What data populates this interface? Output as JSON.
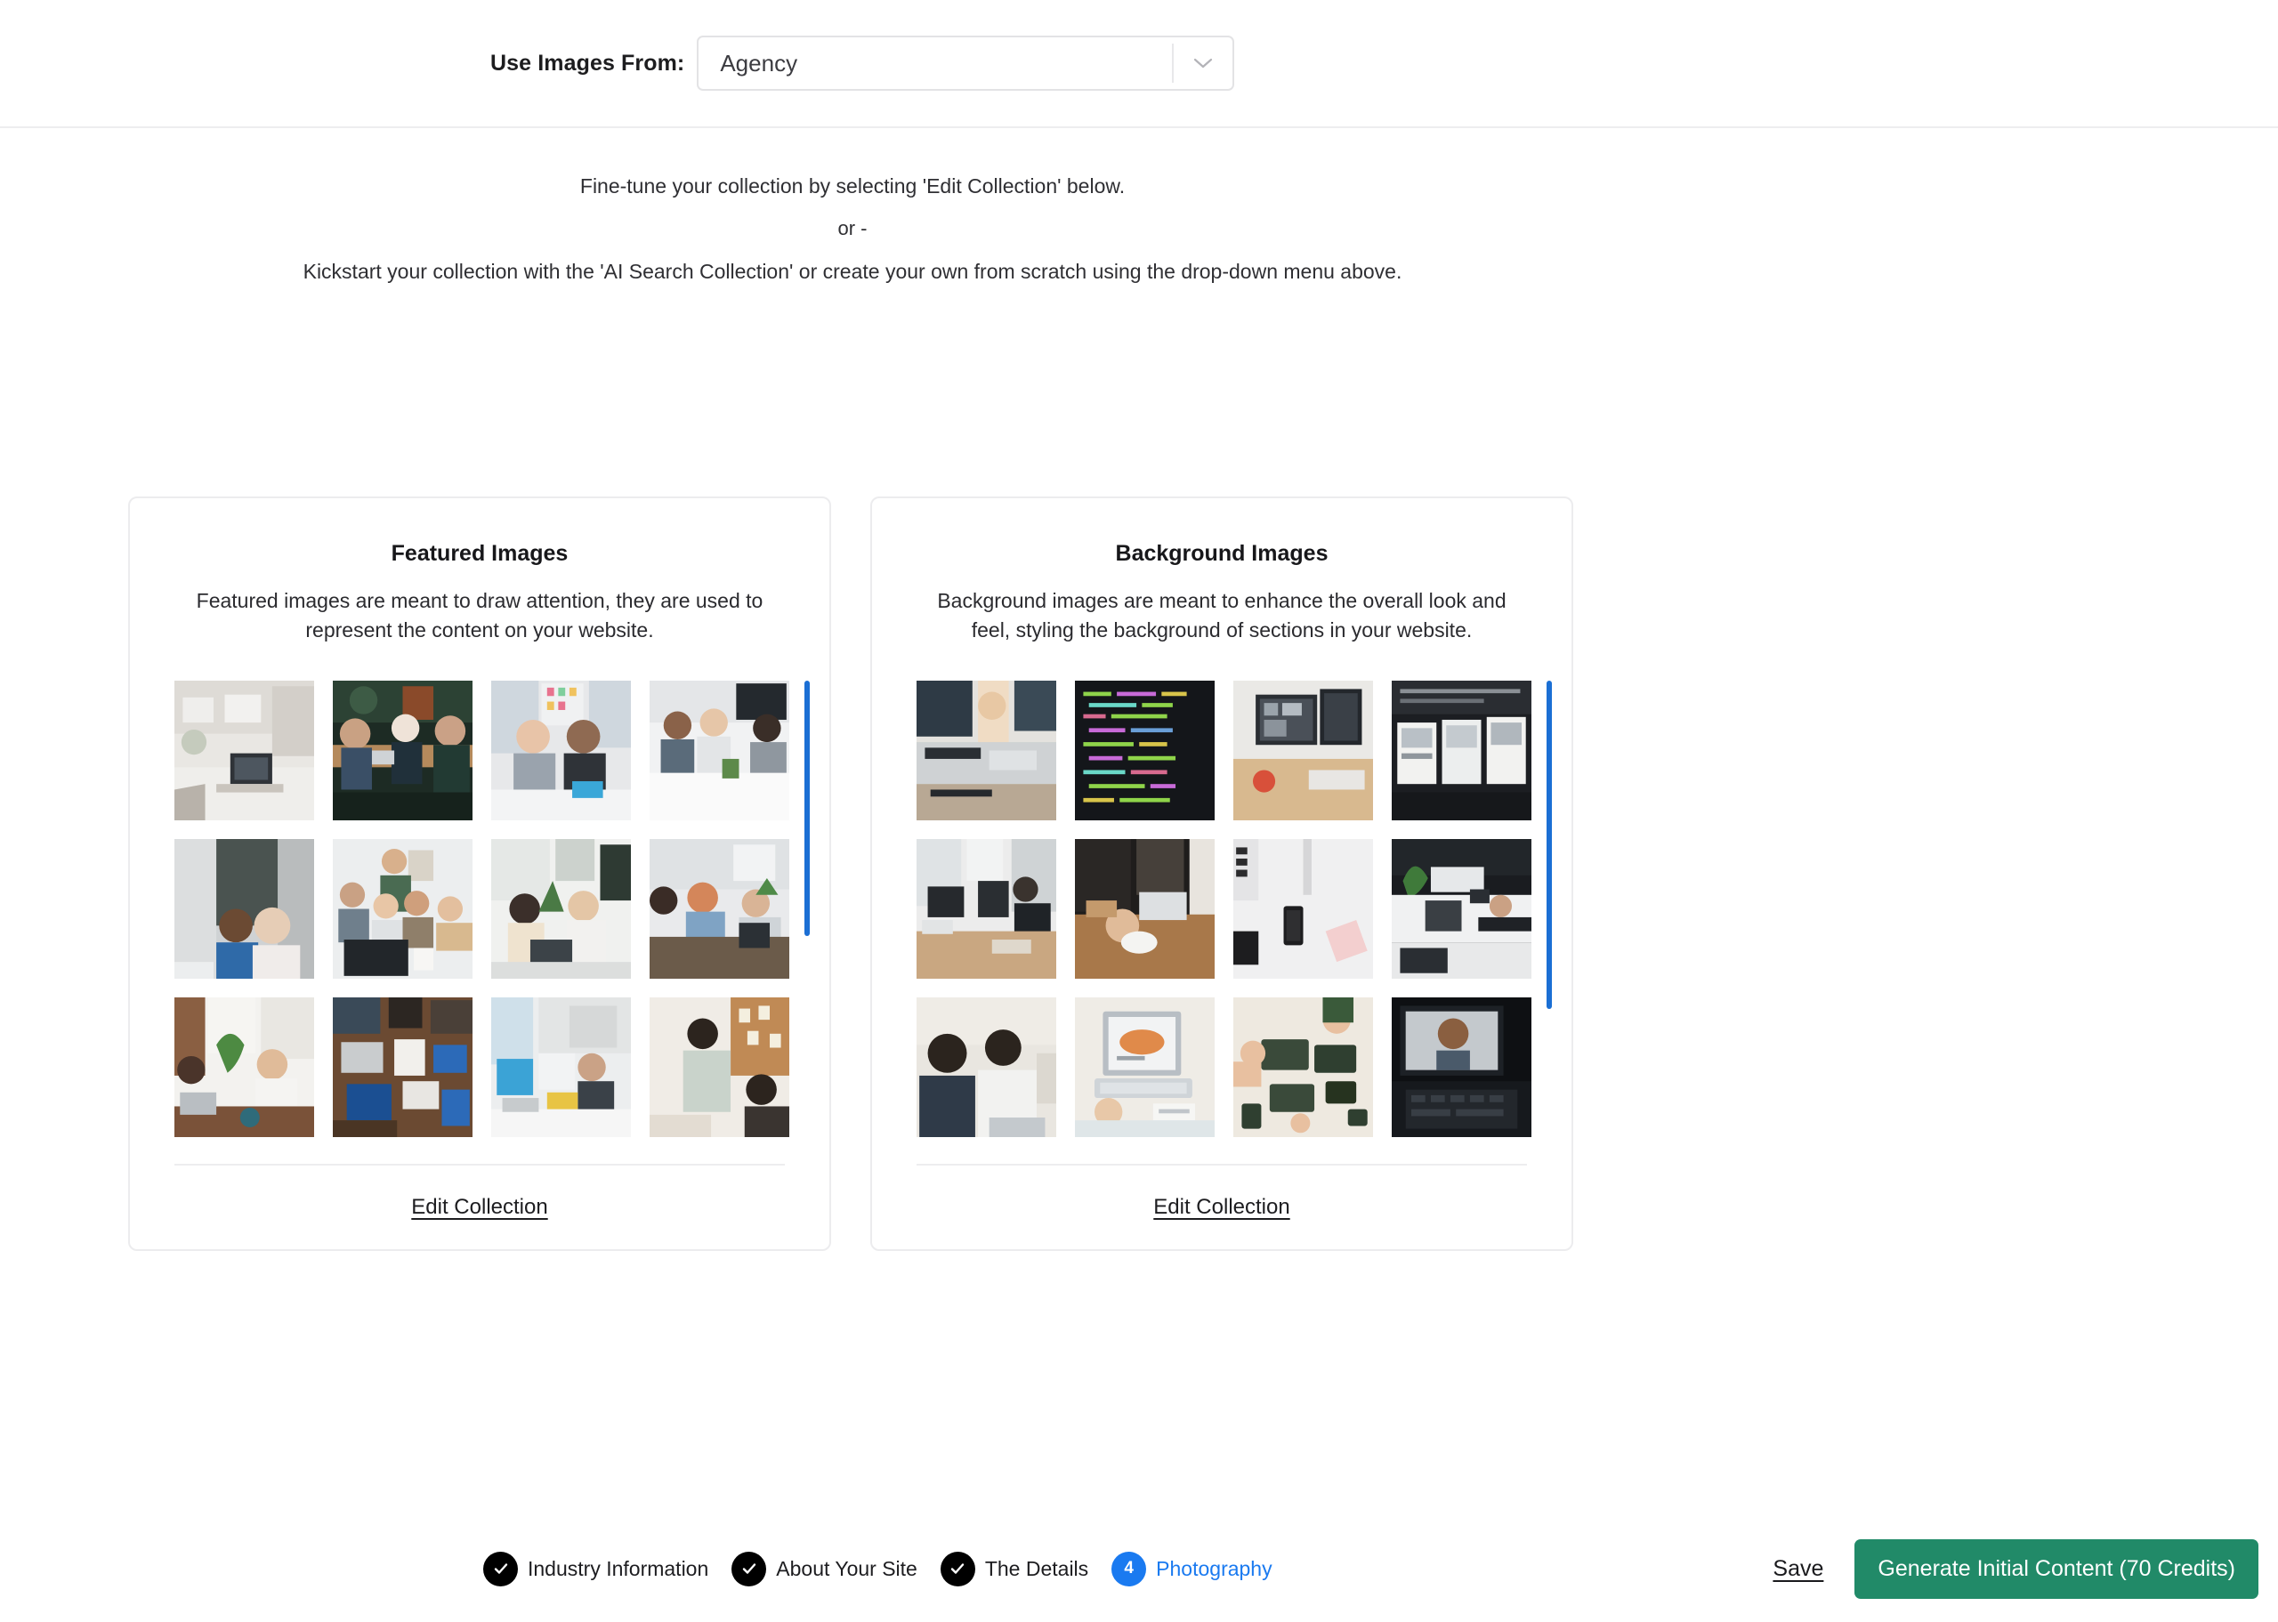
{
  "header": {
    "label": "Use Images From:",
    "select_value": "Agency",
    "select_icon": "chevron-down-icon"
  },
  "intro": {
    "line1": "Fine-tune your collection by selecting 'Edit Collection' below.",
    "line2": "or -",
    "line3": "Kickstart your collection with the 'AI Search Collection' or create your own from scratch using the drop-down menu above."
  },
  "cards": [
    {
      "id": "featured",
      "title": "Featured Images",
      "description": "Featured images are meant to draw attention, they are used to represent the content on your website.",
      "edit_link": "Edit Collection",
      "scroll_percent": 56,
      "thumbnails": [
        "bright-office-laptop-desk",
        "team-meeting-outdoor-table",
        "two-women-whiteboard-meeting",
        "four-people-conference-table",
        "two-women-talking-desk",
        "team-group-around-laptop",
        "two-people-plants-laptops",
        "colleagues-laptops-workspace",
        "men-meeting-plant-window",
        "overhead-desk-devices",
        "open-office-monitors",
        "woman-presenting-corkboard"
      ]
    },
    {
      "id": "background",
      "title": "Background Images",
      "description": "Background images are meant to enhance the overall look and feel, styling the background of sections in your website.",
      "edit_link": "Edit Collection",
      "scroll_percent": 72,
      "thumbnails": [
        "people-hands-notebook-desk",
        "code-editor-dark-screen",
        "imac-monitors-desk",
        "wall-of-screens-dark",
        "office-desks-monitors",
        "hand-on-mouse-wood-desk",
        "flatlay-phone-white-desk",
        "plants-table-laptops",
        "two-men-laptop-study",
        "laptop-chart-paperwork",
        "overhead-keyboards-hands",
        "laptop-video-call-dark"
      ]
    }
  ],
  "footer": {
    "steps": [
      {
        "label": "Industry Information",
        "state": "done",
        "badge": "✓"
      },
      {
        "label": "About Your Site",
        "state": "done",
        "badge": "✓"
      },
      {
        "label": "The Details",
        "state": "done",
        "badge": "✓"
      },
      {
        "label": "Photography",
        "state": "active",
        "badge": "4"
      }
    ],
    "save_label": "Save",
    "generate_label": "Generate Initial Content (70 Credits)"
  },
  "colors": {
    "accent_blue": "#1a7af0",
    "scrollbar_blue": "#1b6fd4",
    "generate_green": "#218a68",
    "border_gray": "#ececee",
    "text_dark": "#1d1d20"
  }
}
